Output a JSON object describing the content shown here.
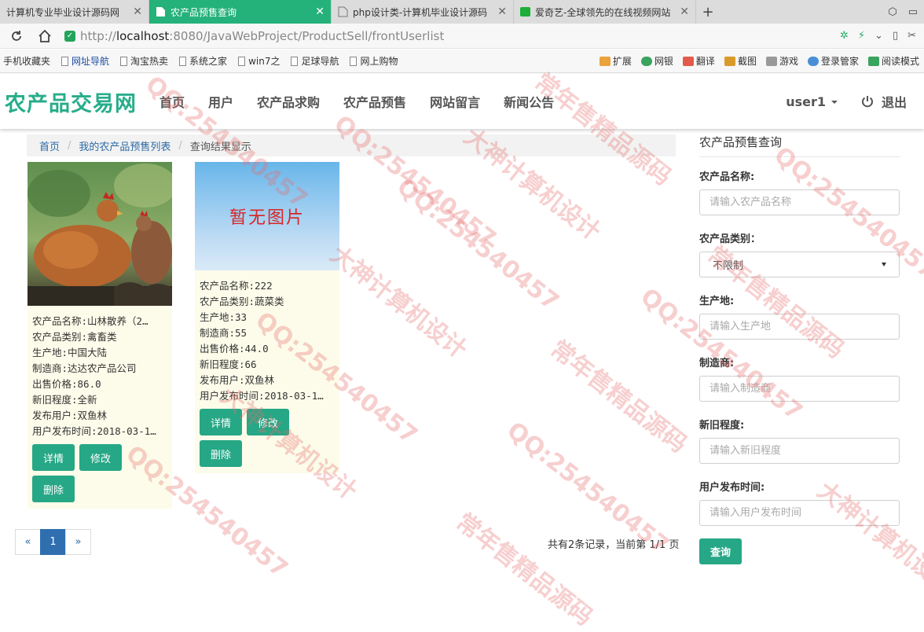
{
  "browser": {
    "tabs": [
      {
        "label": "计算机专业毕业设计源码网",
        "active": false
      },
      {
        "label": "农产品预售查询",
        "active": true
      },
      {
        "label": "php设计类-计算机毕业设计源码",
        "active": false
      },
      {
        "label": "爱奇艺-全球领先的在线视频网站",
        "active": false
      }
    ],
    "new_tab": "+",
    "url_prefix": "http://",
    "url_host": "localhost",
    "url_rest": ":8080/JavaWebProject/ProductSell/frontUserlist",
    "bookmarks": [
      "手机收藏夹",
      "网址导航",
      "淘宝热卖",
      "系统之家",
      "win7之",
      "足球导航",
      "网上购物"
    ],
    "bookmark_tools": [
      "扩展",
      "网银",
      "翻译",
      "截图",
      "游戏",
      "登录管家",
      "阅读模式"
    ]
  },
  "navbar": {
    "brand": "农产品交易网",
    "menu": [
      "首页",
      "用户",
      "农产品求购",
      "农产品预售",
      "网站留言",
      "新闻公告"
    ],
    "user": "user1",
    "logout": "退出"
  },
  "breadcrumb": {
    "home": "首页",
    "list": "我的农产品预售列表",
    "current": "查询结果显示",
    "sep": "/"
  },
  "products": [
    {
      "name": "农产品名称:山林散养（2…",
      "category": "农产品类别:禽畜类",
      "origin": "生产地:中国大陆",
      "maker": "制造商:达达农产品公司",
      "price": "出售价格:86.0",
      "condition": "新旧程度:全新",
      "publisher": "发布用户:双鱼林",
      "time": "用户发布时间:2018-03-1…",
      "has_image": true
    },
    {
      "name": "农产品名称:222",
      "category": "农产品类别:蔬菜类",
      "origin": "生产地:33",
      "maker": "制造商:55",
      "price": "出售价格:44.0",
      "condition": "新旧程度:66",
      "publisher": "发布用户:双鱼林",
      "time": "用户发布时间:2018-03-1…",
      "has_image": false,
      "no_image_text": "暂无图片"
    }
  ],
  "card_buttons": {
    "detail": "详情",
    "edit": "修改",
    "delete": "删除"
  },
  "search": {
    "title": "农产品预售查询",
    "name_label": "农产品名称:",
    "name_placeholder": "请输入农产品名称",
    "category_label": "农产品类别：",
    "category_value": "不限制",
    "origin_label": "生产地:",
    "origin_placeholder": "请输入生产地",
    "maker_label": "制造商:",
    "maker_placeholder": "请输入制造商",
    "condition_label": "新旧程度:",
    "condition_placeholder": "请输入新旧程度",
    "time_label": "用户发布时间:",
    "time_placeholder": "请输入用户发布时间",
    "submit": "查询"
  },
  "pagination": {
    "prev": "«",
    "page": "1",
    "next": "»",
    "summary": "共有2条记录，当前第 1/1 页"
  },
  "watermarks": [
    "QQ:254540457",
    "大神计算机设计",
    "常年售精品源码"
  ],
  "colors": {
    "brand": "#27ad8a",
    "button": "#26a786",
    "active_tab": "#24b27a",
    "page_active": "#2f6fb0"
  }
}
